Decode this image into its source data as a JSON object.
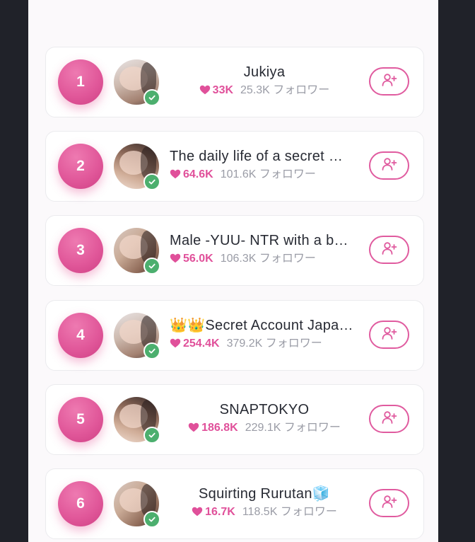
{
  "follower_suffix": "フォロワー",
  "colors": {
    "accent": "#e0509a",
    "verified": "#4caf6e",
    "background": "#202229"
  },
  "creators": [
    {
      "rank": "1",
      "name": "Jukiya",
      "likes": "33K",
      "followers": "25.3K",
      "verified": true,
      "avatar_icon": "creator-avatar"
    },
    {
      "rank": "2",
      "name": "The daily life of a secret …",
      "likes": "64.6K",
      "followers": "101.6K",
      "verified": true,
      "avatar_icon": "creator-avatar"
    },
    {
      "rank": "3",
      "name": "Male -YUU- NTR with a b…",
      "likes": "56.0K",
      "followers": "106.3K",
      "verified": true,
      "avatar_icon": "creator-avatar"
    },
    {
      "rank": "4",
      "name": "👑👑Secret Account Japa…",
      "likes": "254.4K",
      "followers": "379.2K",
      "verified": true,
      "avatar_icon": "creator-avatar"
    },
    {
      "rank": "5",
      "name": "SNAPTOKYO",
      "likes": "186.8K",
      "followers": "229.1K",
      "verified": true,
      "avatar_icon": "creator-avatar"
    },
    {
      "rank": "6",
      "name": "Squirting Rurutan🧊",
      "likes": "16.7K",
      "followers": "118.5K",
      "verified": true,
      "avatar_icon": "creator-avatar"
    }
  ]
}
